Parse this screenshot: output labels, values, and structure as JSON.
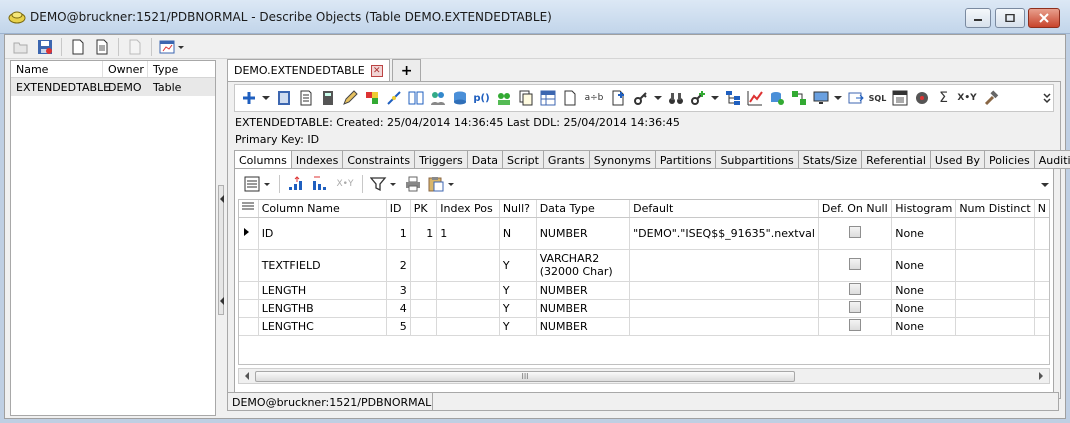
{
  "window": {
    "title": "DEMO@bruckner:1521/PDBNORMAL - Describe Objects (Table DEMO.EXTENDEDTABLE)"
  },
  "left_panel": {
    "columns": [
      "Name",
      "Owner",
      "Type"
    ],
    "rows": [
      {
        "name": "EXTENDEDTABLE",
        "owner": "DEMO",
        "type": "Table"
      }
    ]
  },
  "doc_tabs": [
    {
      "label": "DEMO.EXTENDEDTABLE",
      "active": true
    },
    {
      "label": "+",
      "active": false
    }
  ],
  "object_info": {
    "line1": "EXTENDEDTABLE:   Created: 25/04/2014 14:36:45   Last DDL: 25/04/2014 14:36:45",
    "line2": "Primary Key:  ID"
  },
  "sub_tabs": [
    "Columns",
    "Indexes",
    "Constraints",
    "Triggers",
    "Data",
    "Script",
    "Grants",
    "Synonyms",
    "Partitions",
    "Subpartitions",
    "Stats/Size",
    "Referential",
    "Used By",
    "Policies",
    "Auditing"
  ],
  "active_sub_tab": "Columns",
  "toolbar_text": {
    "ab": "a÷b",
    "pio": "p()",
    "xy": "X•Y",
    "sum": "Σ",
    "sql": "SQL"
  },
  "grid": {
    "columns": [
      "Column Name",
      "ID",
      "PK",
      "Index Pos",
      "Null?",
      "Data Type",
      "Default",
      "Def. On Null",
      "Histogram",
      "Num Distinct",
      "N"
    ],
    "rows": [
      {
        "name": "ID",
        "id": "1",
        "pk": "1",
        "index_pos": "1",
        "null": "N",
        "data_type": "NUMBER",
        "default": "\"DEMO\".\"ISEQ$$_91635\".nextval",
        "def_on_null": false,
        "histogram": "None",
        "num_distinct": "",
        "current": true
      },
      {
        "name": "TEXTFIELD",
        "id": "2",
        "pk": "",
        "index_pos": "",
        "null": "Y",
        "data_type": "VARCHAR2 (32000 Char)",
        "default": "",
        "def_on_null": false,
        "histogram": "None",
        "num_distinct": "",
        "current": false
      },
      {
        "name": "LENGTH",
        "id": "3",
        "pk": "",
        "index_pos": "",
        "null": "Y",
        "data_type": "NUMBER",
        "default": "",
        "def_on_null": false,
        "histogram": "None",
        "num_distinct": "",
        "current": false
      },
      {
        "name": "LENGTHB",
        "id": "4",
        "pk": "",
        "index_pos": "",
        "null": "Y",
        "data_type": "NUMBER",
        "default": "",
        "def_on_null": false,
        "histogram": "None",
        "num_distinct": "",
        "current": false
      },
      {
        "name": "LENGTHC",
        "id": "5",
        "pk": "",
        "index_pos": "",
        "null": "Y",
        "data_type": "NUMBER",
        "default": "",
        "def_on_null": false,
        "histogram": "None",
        "num_distinct": "",
        "current": false
      }
    ]
  },
  "scroll_grip": "III",
  "status_bar": {
    "connection": "DEMO@bruckner:1521/PDBNORMAL",
    "extra": ""
  },
  "colors": {
    "titlebar": "#c2d5ea",
    "accent_blue": "#1f5fbf",
    "close_button": "#c8442c"
  }
}
